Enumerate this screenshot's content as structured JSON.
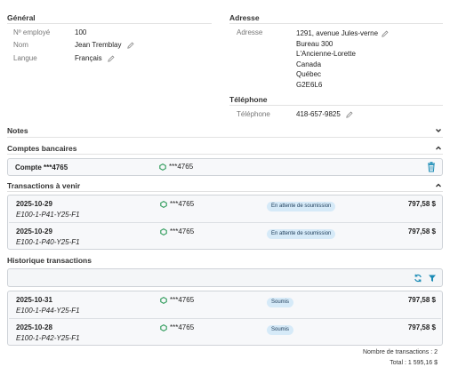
{
  "general": {
    "title": "Général",
    "employee_label": "Nº employé",
    "employee_value": "100",
    "name_label": "Nom",
    "name_value": "Jean Tremblay",
    "lang_label": "Langue",
    "lang_value": "Français"
  },
  "address": {
    "title": "Adresse",
    "label": "Adresse",
    "lines": [
      "1291, avenue Jules-verne",
      "Bureau 300",
      "L'Ancienne-Lorette",
      "Canada",
      "Québec",
      "G2E6L6"
    ]
  },
  "phone": {
    "title": "Téléphone",
    "label": "Téléphone",
    "value": "418-657-9825"
  },
  "notes": {
    "title": "Notes"
  },
  "bank": {
    "title": "Comptes bancaires",
    "account_name": "Compte ***4765",
    "account_masked": "***4765"
  },
  "upcoming": {
    "title": "Transactions à venir",
    "rows": [
      {
        "date": "2025-10-29",
        "ref": "E100-1-P41-Y25-F1",
        "account": "***4765",
        "status": "En attente de soumission",
        "amount": "797,58 $"
      },
      {
        "date": "2025-10-29",
        "ref": "E100-1-P40-Y25-F1",
        "account": "***4765",
        "status": "En attente de soumission",
        "amount": "797,58 $"
      }
    ]
  },
  "history": {
    "title": "Historique transactions",
    "rows": [
      {
        "date": "2025-10-31",
        "ref": "E100-1-P44-Y25-F1",
        "account": "***4765",
        "status": "Soumis",
        "amount": "797,58 $"
      },
      {
        "date": "2025-10-28",
        "ref": "E100-1-P42-Y25-F1",
        "account": "***4765",
        "status": "Soumis",
        "amount": "797,58 $"
      }
    ],
    "count_text": "Nombre de transactions : 2",
    "total_text": "Total : 1 595,16 $"
  },
  "colors": {
    "accent": "#1a8bb5",
    "account_green": "#2e9b5a",
    "badge_bg": "#d6eaf8"
  }
}
